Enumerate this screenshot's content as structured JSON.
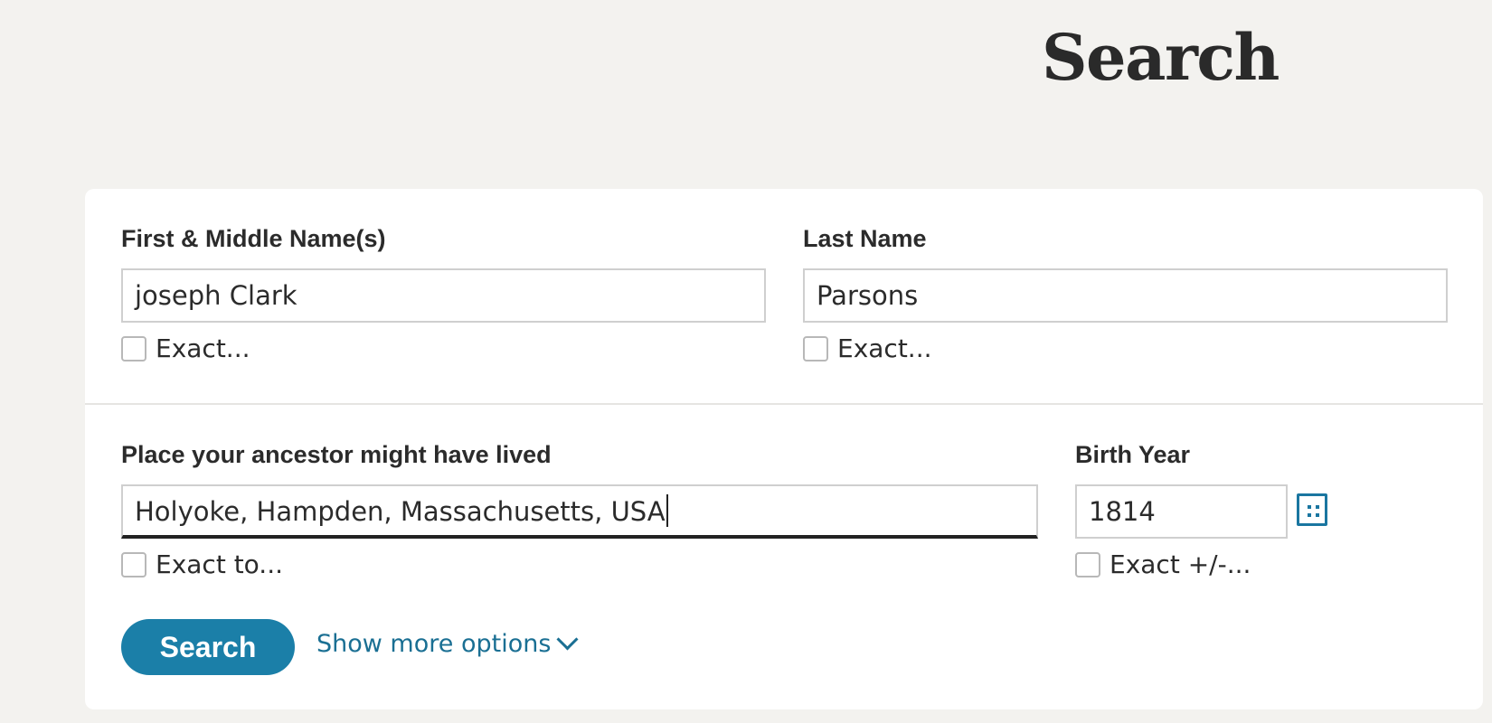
{
  "page": {
    "title": "Search"
  },
  "form": {
    "first_name": {
      "label": "First & Middle Name(s)",
      "value": "joseph Clark",
      "exact_label": "Exact..."
    },
    "last_name": {
      "label": "Last Name",
      "value": "Parsons",
      "exact_label": "Exact..."
    },
    "place": {
      "label": "Place your ancestor might have lived",
      "value": "Holyoke, Hampden, Massachusetts, USA",
      "exact_label": "Exact to..."
    },
    "birth_year": {
      "label": "Birth Year",
      "value": "1814",
      "exact_label": "Exact +/-..."
    },
    "search_button": "Search",
    "more_options_link": "Show more options"
  },
  "colors": {
    "accent": "#1b7fa8",
    "link": "#1a6f93",
    "background": "#f3f2ef",
    "card": "#ffffff"
  },
  "icons": {
    "calendar_picker": "calendar-icon",
    "more_options": "chevron-down-icon"
  }
}
